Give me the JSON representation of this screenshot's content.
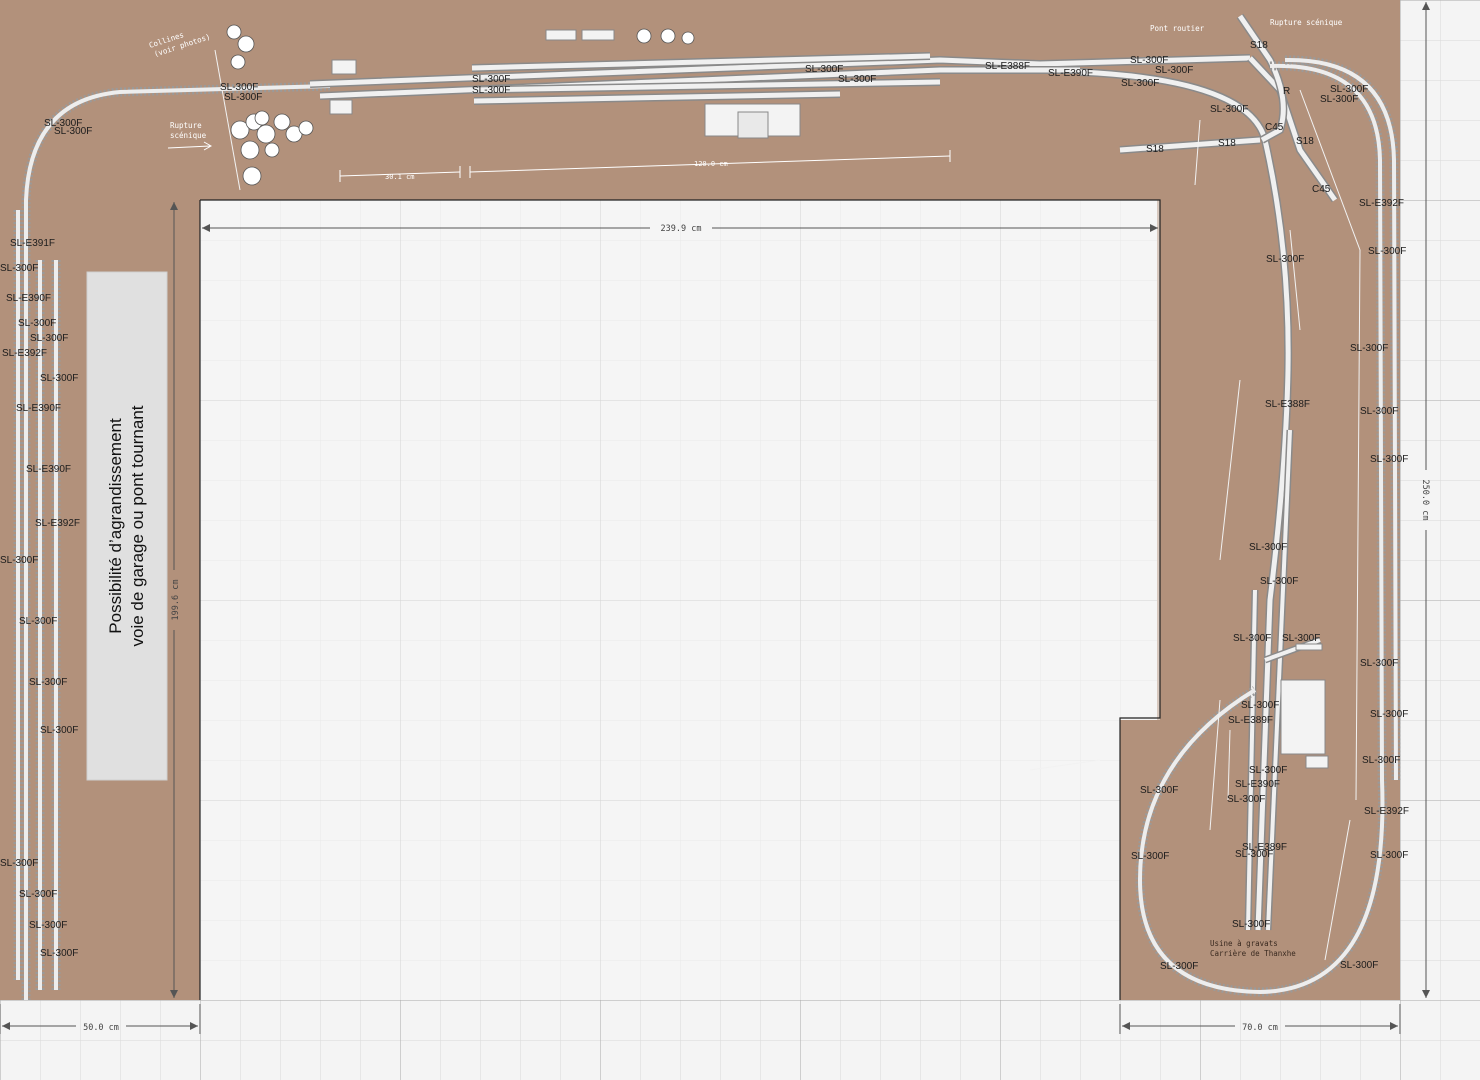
{
  "dimensions": {
    "top_length": "30.1 cm",
    "top_main": "120.0 cm",
    "inner_width": "239.9 cm",
    "left_height": "199.6 cm",
    "right_height": "250.0 cm",
    "bottom_left": "50.0 cm",
    "bottom_right": "70.0 cm"
  },
  "annotations": {
    "collines_1": "Collines",
    "collines_2": "(voir photos)",
    "rupture_left_1": "Rupture",
    "rupture_left_2": "scénique",
    "pont_routier": "Pont routier",
    "rupture_right": "Rupture scénique",
    "usine_1": "Usine à gravats",
    "usine_2": "Carrière de Thanxhe"
  },
  "extension_note": {
    "line1": "Possibilité d’agrandissement",
    "line2": "voie de garage ou pont tournant"
  },
  "track_labels": {
    "sl300": "SL-300F",
    "e388": "SL-E388F",
    "e390": "SL-E390F",
    "e391": "SL-E391F",
    "e392": "SL-E392F",
    "e389": "SL-E389F",
    "s18": "S18",
    "c45": "C45",
    "r": "R"
  },
  "colors": {
    "board": "#b2917b",
    "grid_bg": "#f4f4f4",
    "grid_line": "#d6d6d6",
    "track": "#e8e8e8"
  }
}
